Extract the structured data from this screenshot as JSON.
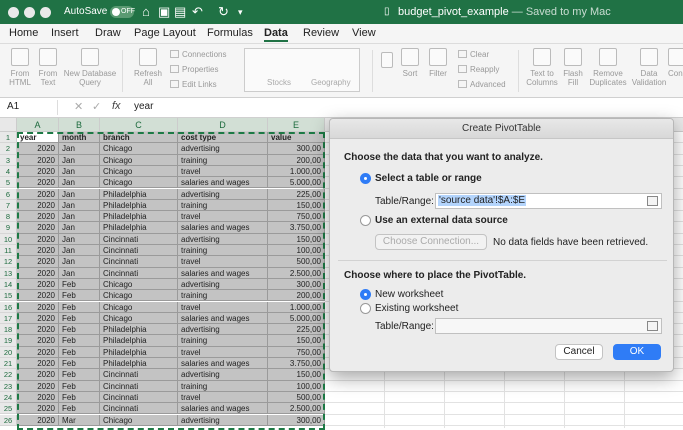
{
  "titlebar": {
    "autosave": "AutoSave",
    "toggle": "OFF",
    "doc_name": "budget_pivot_example",
    "doc_status": "— Saved to my Mac"
  },
  "tabs": [
    "Home",
    "Insert",
    "Draw",
    "Page Layout",
    "Formulas",
    "Data",
    "Review",
    "View"
  ],
  "active_tab": "Data",
  "ribbon": {
    "from_html": "From\nHTML",
    "from_text": "From\nText",
    "new_db_query": "New Database\nQuery",
    "refresh_all": "Refresh\nAll",
    "connections": "Connections",
    "properties": "Properties",
    "edit_links": "Edit Links",
    "stocks": "Stocks",
    "geography": "Geography",
    "sort": "Sort",
    "filter": "Filter",
    "clear": "Clear",
    "reapply": "Reapply",
    "advanced": "Advanced",
    "text_to_columns": "Text to\nColumns",
    "flash_fill": "Flash\nFill",
    "remove_duplicates": "Remove\nDuplicates",
    "data_validation": "Data\nValidation",
    "cons": "Cons"
  },
  "formula_bar": {
    "name_box": "A1",
    "fx": "fx",
    "value": "year"
  },
  "columns": [
    "A",
    "B",
    "C",
    "D",
    "E"
  ],
  "rows": [
    [
      "year",
      "month",
      "branch",
      "cost type",
      "value"
    ],
    [
      "2020",
      "Jan",
      "Chicago",
      "advertising",
      "300,00"
    ],
    [
      "2020",
      "Jan",
      "Chicago",
      "training",
      "200,00"
    ],
    [
      "2020",
      "Jan",
      "Chicago",
      "travel",
      "1.000,00"
    ],
    [
      "2020",
      "Jan",
      "Chicago",
      "salaries and wages",
      "5.000,00"
    ],
    [
      "2020",
      "Jan",
      "Philadelphia",
      "advertising",
      "225,00"
    ],
    [
      "2020",
      "Jan",
      "Philadelphia",
      "training",
      "150,00"
    ],
    [
      "2020",
      "Jan",
      "Philadelphia",
      "travel",
      "750,00"
    ],
    [
      "2020",
      "Jan",
      "Philadelphia",
      "salaries and wages",
      "3.750,00"
    ],
    [
      "2020",
      "Jan",
      "Cincinnati",
      "advertising",
      "150,00"
    ],
    [
      "2020",
      "Jan",
      "Cincinnati",
      "training",
      "100,00"
    ],
    [
      "2020",
      "Jan",
      "Cincinnati",
      "travel",
      "500,00"
    ],
    [
      "2020",
      "Jan",
      "Cincinnati",
      "salaries and wages",
      "2.500,00"
    ],
    [
      "2020",
      "Feb",
      "Chicago",
      "advertising",
      "300,00"
    ],
    [
      "2020",
      "Feb",
      "Chicago",
      "training",
      "200,00"
    ],
    [
      "2020",
      "Feb",
      "Chicago",
      "travel",
      "1.000,00"
    ],
    [
      "2020",
      "Feb",
      "Chicago",
      "salaries and wages",
      "5.000,00"
    ],
    [
      "2020",
      "Feb",
      "Philadelphia",
      "advertising",
      "225,00"
    ],
    [
      "2020",
      "Feb",
      "Philadelphia",
      "training",
      "150,00"
    ],
    [
      "2020",
      "Feb",
      "Philadelphia",
      "travel",
      "750,00"
    ],
    [
      "2020",
      "Feb",
      "Philadelphia",
      "salaries and wages",
      "3.750,00"
    ],
    [
      "2020",
      "Feb",
      "Cincinnati",
      "advertising",
      "150,00"
    ],
    [
      "2020",
      "Feb",
      "Cincinnati",
      "training",
      "100,00"
    ],
    [
      "2020",
      "Feb",
      "Cincinnati",
      "travel",
      "500,00"
    ],
    [
      "2020",
      "Feb",
      "Cincinnati",
      "salaries and wages",
      "2.500,00"
    ],
    [
      "2020",
      "Mar",
      "Chicago",
      "advertising",
      "300,00"
    ]
  ],
  "dialog": {
    "title": "Create PivotTable",
    "choose_data": "Choose the data that you want to analyze.",
    "select_table": "Select a table or range",
    "table_range_label": "Table/Range:",
    "table_range_value": "'source data'!$A:$E",
    "external_source": "Use an external data source",
    "choose_connection": "Choose Connection...",
    "no_fields": "No data fields have been retrieved.",
    "choose_place": "Choose where to place the PivotTable.",
    "new_worksheet": "New worksheet",
    "existing_worksheet": "Existing worksheet",
    "table_range_label2": "Table/Range:",
    "cancel": "Cancel",
    "ok": "OK"
  }
}
